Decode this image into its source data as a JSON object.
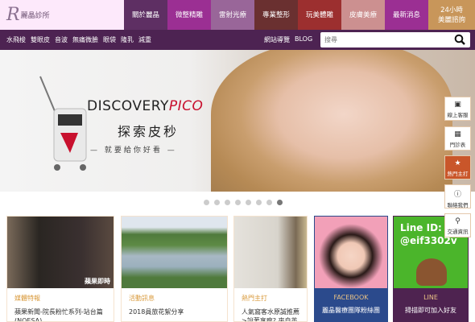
{
  "logo": {
    "mark": "R",
    "text": "麗晶診所"
  },
  "nav": [
    {
      "label": "關於麗晶",
      "color": "#5e2f63"
    },
    {
      "label": "微整精雕",
      "color": "#9b2f93"
    },
    {
      "label": "雷射光療",
      "color": "#996699"
    },
    {
      "label": "專業整形",
      "color": "#6a3030"
    },
    {
      "label": "玩美體雕",
      "color": "#9c2f2f"
    },
    {
      "label": "皮膚美療",
      "color": "#cc9090"
    },
    {
      "label": "最新消息",
      "color": "#9b2f93"
    },
    {
      "label": "24小時\n美麗諮詢",
      "color": "#c8965a"
    }
  ],
  "subnav": [
    "水飛梭",
    "雙眼皮",
    "音波",
    "無痛微臉",
    "眼袋",
    "隆乳",
    "減重"
  ],
  "links": {
    "sitemap": "網站導覽",
    "blog": "BLOG"
  },
  "search": {
    "placeholder": "搜尋"
  },
  "hero": {
    "brand": "DISCOVERY",
    "brand_accent": "PICO",
    "headline": "探索皮秒",
    "tagline": "— 就要給你好看 —"
  },
  "carousel": {
    "count": 8,
    "active": 7
  },
  "cards": [
    {
      "category": "媒體特報",
      "title": "蘋果新聞-院長粉忙系列-站台篇(NOESA)",
      "img_label": "蘋果即時"
    },
    {
      "category": "活動訊息",
      "title": "2018員旅花絮分享"
    },
    {
      "category": "熱門主打",
      "title": "人氣窩客水原誠推薦 >說著享瘦? 來自英"
    },
    {
      "category": "FACEBOOK",
      "title": "麗晶醫療團隊粉絲團"
    },
    {
      "category": "LINE",
      "title": "掃描即可加入好友",
      "img_label": "Line ID:\n@eif3302v"
    }
  ],
  "sidebar": [
    {
      "label": "線上客服",
      "icon": "contact-icon"
    },
    {
      "label": "門診表",
      "icon": "calendar-icon"
    },
    {
      "label": "熱門主打",
      "icon": "star-icon",
      "active": true
    },
    {
      "label": "聯絡我們",
      "icon": "info-icon"
    },
    {
      "label": "交通資訊",
      "icon": "map-pin-icon"
    }
  ]
}
